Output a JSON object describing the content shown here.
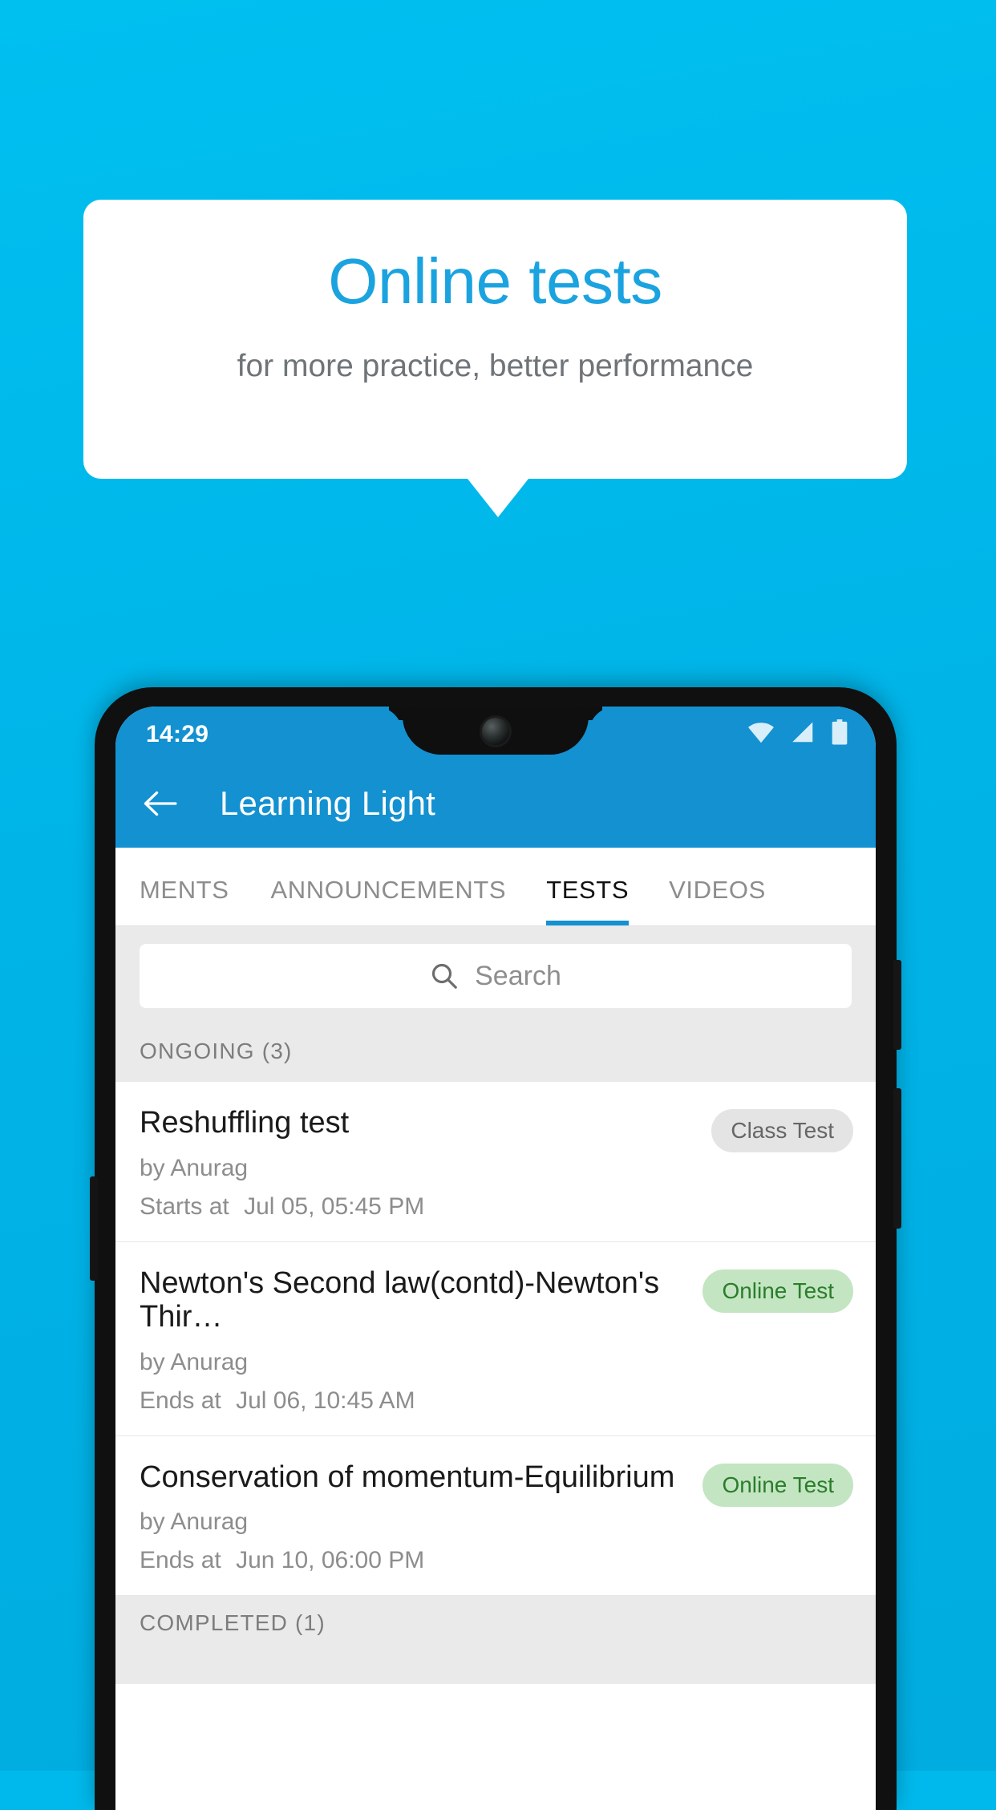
{
  "promo": {
    "title": "Online tests",
    "subtitle": "for more practice, better performance",
    "background_color": "#00b4e8",
    "title_color": "#1ba3e0"
  },
  "phone": {
    "status_bar": {
      "time": "14:29",
      "icons": [
        "wifi-icon",
        "signal-icon",
        "battery-icon"
      ],
      "background_color": "#1391d1"
    },
    "app_bar": {
      "back_icon": "back-arrow-icon",
      "title": "Learning Light",
      "background_color": "#1391d1"
    },
    "tabs": [
      {
        "label": "MENTS",
        "active": false
      },
      {
        "label": "ANNOUNCEMENTS",
        "active": false
      },
      {
        "label": "TESTS",
        "active": true
      },
      {
        "label": "VIDEOS",
        "active": false
      }
    ],
    "search": {
      "icon": "search-icon",
      "placeholder": "Search",
      "value": ""
    },
    "sections": [
      {
        "header": "ONGOING (3)",
        "items": [
          {
            "title": "Reshuffling test",
            "author": "by Anurag",
            "time_label": "Starts at",
            "time_value": "Jul 05, 05:45 PM",
            "badge": "Class Test",
            "badge_type": "class-test"
          },
          {
            "title": "Newton's Second law(contd)-Newton's Thir…",
            "author": "by Anurag",
            "time_label": "Ends at",
            "time_value": "Jul 06, 10:45 AM",
            "badge": "Online Test",
            "badge_type": "online-test"
          },
          {
            "title": "Conservation of momentum-Equilibrium",
            "author": "by Anurag",
            "time_label": "Ends at",
            "time_value": "Jun 10, 06:00 PM",
            "badge": "Online Test",
            "badge_type": "online-test"
          }
        ]
      },
      {
        "header": "COMPLETED (1)",
        "items": []
      }
    ]
  }
}
